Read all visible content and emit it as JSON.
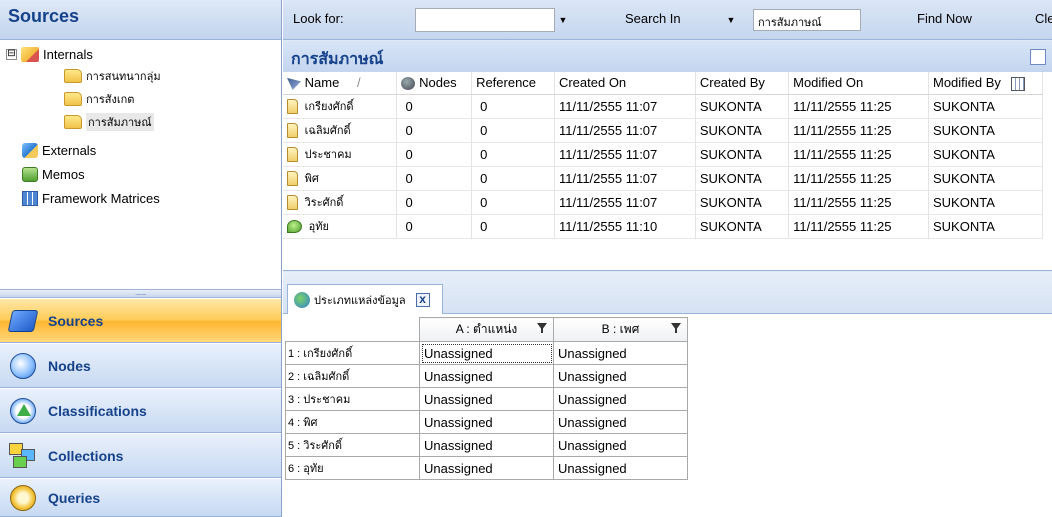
{
  "left_panel": {
    "title": "Sources",
    "tree": [
      {
        "label": "Internals",
        "icon": "internals-folder-icon",
        "expanded": true
      },
      {
        "label": "การสนทนากลุ่ม",
        "icon": "folder-icon"
      },
      {
        "label": "การสังเกต",
        "icon": "folder-icon"
      },
      {
        "label": "การสัมภาษณ์",
        "icon": "folder-icon",
        "selected": true
      },
      {
        "label": "Externals",
        "icon": "externals-icon"
      },
      {
        "label": "Memos",
        "icon": "memos-icon"
      },
      {
        "label": "Framework Matrices",
        "icon": "framework-matrices-icon"
      }
    ],
    "expander_glyph": "⊟",
    "splitter_grip": ".........",
    "nav": [
      {
        "label": "Sources",
        "icon": "sources-icon",
        "active": true
      },
      {
        "label": "Nodes",
        "icon": "nodes-icon"
      },
      {
        "label": "Classifications",
        "icon": "classifications-icon"
      },
      {
        "label": "Collections",
        "icon": "collections-icon"
      },
      {
        "label": "Queries",
        "icon": "queries-icon"
      }
    ]
  },
  "toolbar": {
    "look_for_label": "Look for:",
    "look_for_value": "",
    "dropdown_glyph": "▼",
    "search_in_label": "Search In",
    "search_in_value": "การสัมภาษณ์",
    "find_now_label": "Find Now",
    "clear_label": "Cle"
  },
  "list": {
    "title": "การสัมภาษณ์",
    "columns": [
      "Name",
      "Nodes",
      "Reference",
      "Created On",
      "Created By",
      "Modified On",
      "Modified By"
    ],
    "sort_glyph": "/",
    "rows": [
      {
        "icon": "document-icon",
        "name": "เกรียงศักดิ์",
        "nodes": "0",
        "reference": "0",
        "created_on": "11/11/2555 11:07",
        "created_by": "SUKONTA",
        "modified_on": "11/11/2555 11:25",
        "modified_by": "SUKONTA"
      },
      {
        "icon": "document-icon",
        "name": "เฉลิมศักดิ์",
        "nodes": "0",
        "reference": "0",
        "created_on": "11/11/2555 11:07",
        "created_by": "SUKONTA",
        "modified_on": "11/11/2555 11:25",
        "modified_by": "SUKONTA"
      },
      {
        "icon": "document-icon",
        "name": "ประชาคม",
        "nodes": "0",
        "reference": "0",
        "created_on": "11/11/2555 11:07",
        "created_by": "SUKONTA",
        "modified_on": "11/11/2555 11:25",
        "modified_by": "SUKONTA"
      },
      {
        "icon": "document-icon",
        "name": "พิศ",
        "nodes": "0",
        "reference": "0",
        "created_on": "11/11/2555 11:07",
        "created_by": "SUKONTA",
        "modified_on": "11/11/2555 11:25",
        "modified_by": "SUKONTA"
      },
      {
        "icon": "document-icon",
        "name": "วิระศักดิ์",
        "nodes": "0",
        "reference": "0",
        "created_on": "11/11/2555 11:07",
        "created_by": "SUKONTA",
        "modified_on": "11/11/2555 11:25",
        "modified_by": "SUKONTA"
      },
      {
        "icon": "memo-icon",
        "name": "อุทัย",
        "nodes": "0",
        "reference": "0",
        "created_on": "11/11/2555 11:10",
        "created_by": "SUKONTA",
        "modified_on": "11/11/2555 11:25",
        "modified_by": "SUKONTA"
      }
    ]
  },
  "classification": {
    "tab_label": "ประเภทแหล่งข้อมูล",
    "close_glyph": "x",
    "columns": [
      "A : ตำแหน่ง",
      "B : เพศ"
    ],
    "rows": [
      {
        "label": "1 : เกรียงศักดิ์",
        "a": "Unassigned",
        "b": "Unassigned"
      },
      {
        "label": "2 : เฉลิมศักดิ์",
        "a": "Unassigned",
        "b": "Unassigned"
      },
      {
        "label": "3 : ประชาคม",
        "a": "Unassigned",
        "b": "Unassigned"
      },
      {
        "label": "4 : พิศ",
        "a": "Unassigned",
        "b": "Unassigned"
      },
      {
        "label": "5 : วิระศักดิ์",
        "a": "Unassigned",
        "b": "Unassigned"
      },
      {
        "label": "6 : อุทัย",
        "a": "Unassigned",
        "b": "Unassigned"
      }
    ]
  }
}
